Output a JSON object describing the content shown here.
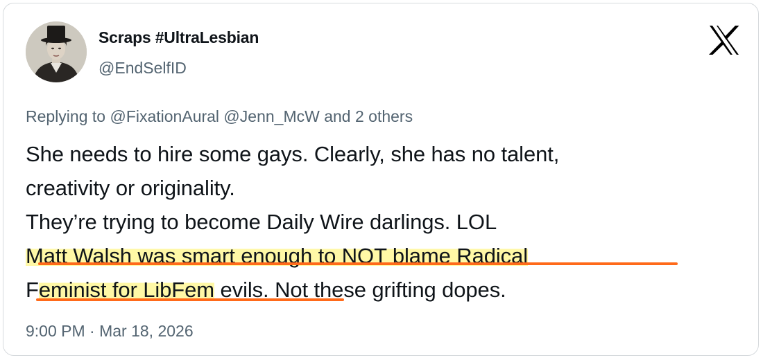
{
  "author": {
    "display_name": "Scraps #UltraLesbian",
    "handle": "@EndSelfID"
  },
  "reply": {
    "prefix": "Replying to",
    "mentions": "@FixationAural @Jenn_McW",
    "suffix": "and 2 others"
  },
  "body": {
    "line1": "She needs to hire some gays. Clearly, she has no talent,",
    "line2": "creativity or originality.",
    "line3": "They’re trying to become Daily Wire darlings. LOL",
    "line4": "Matt Walsh was smart enough to NOT blame Radical",
    "line5_f": "F",
    "line5_highlight": "eminist for LibFem",
    "line5_rest": " evils. Not these grifting dopes."
  },
  "timestamp": "9:00 PM · Mar 18, 2026",
  "colors": {
    "text": "#0f1419",
    "secondary": "#536471",
    "highlight": "#fff8a6",
    "underline": "#ff6a1a"
  },
  "icons": [
    "avatar-image",
    "x-logo-icon"
  ]
}
